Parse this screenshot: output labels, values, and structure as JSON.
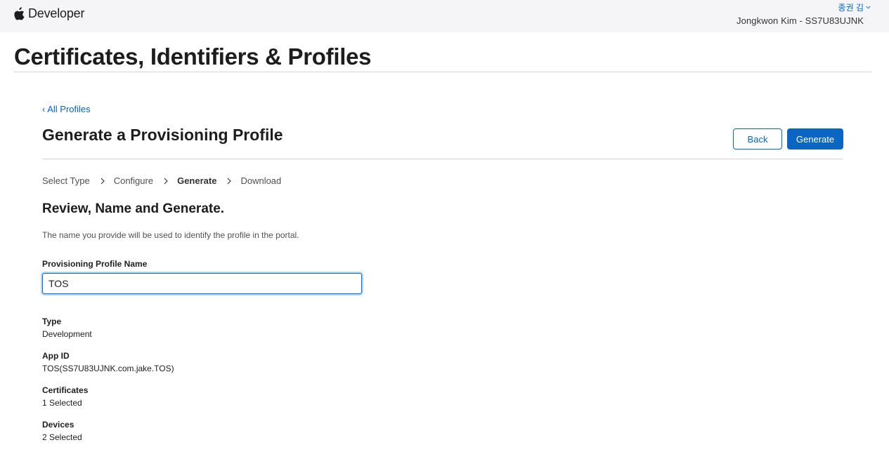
{
  "header": {
    "brand_label": "Developer",
    "user_menu_label": "종권 김",
    "team_line": "Jongkwon Kim - SS7U83UJNK"
  },
  "page": {
    "title": "Certificates, Identifiers & Profiles"
  },
  "content": {
    "back_link": "‹ All Profiles",
    "section_title": "Generate a Provisioning Profile",
    "buttons": {
      "back_label": "Back",
      "generate_label": "Generate"
    },
    "steps": [
      {
        "label": "Select Type",
        "active": false
      },
      {
        "label": "Configure",
        "active": false
      },
      {
        "label": "Generate",
        "active": true
      },
      {
        "label": "Download",
        "active": false
      }
    ],
    "review_title": "Review, Name and Generate.",
    "hint": "The name you provide will be used to identify the profile in the portal.",
    "name_field": {
      "label": "Provisioning Profile Name",
      "value": "TOS"
    },
    "details": [
      {
        "label": "Type",
        "value": "Development"
      },
      {
        "label": "App ID",
        "value": "TOS(SS7U83UJNK.com.jake.TOS)"
      },
      {
        "label": "Certificates",
        "value": "1 Selected"
      },
      {
        "label": "Devices",
        "value": "2 Selected"
      }
    ]
  },
  "colors": {
    "accent": "#0066cc",
    "primary_button": "#0a66c2",
    "topbar_bg": "#f5f5f7",
    "rule": "#d2d2d7"
  },
  "icons": {
    "brand": "apple-logo-icon",
    "user_menu": "chevron-down-icon",
    "step_separator": "chevron-right-icon"
  }
}
